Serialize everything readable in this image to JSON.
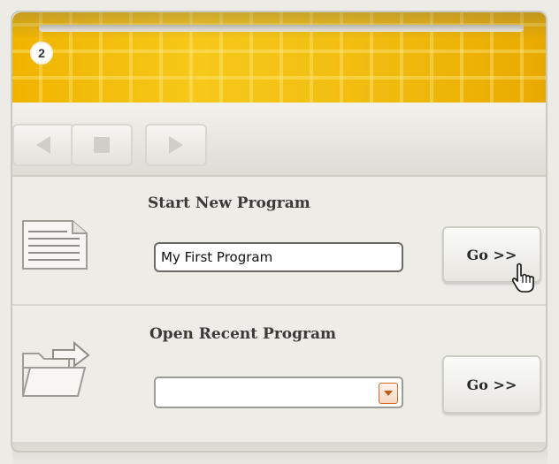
{
  "header": {
    "step_number": "2"
  },
  "toolbar": {
    "buttons": [
      {
        "name": "back",
        "icon": "triangle-left-icon"
      },
      {
        "name": "stop",
        "icon": "square-stop-icon"
      },
      {
        "name": "play",
        "icon": "triangle-right-icon"
      }
    ]
  },
  "start_new": {
    "title": "Start New Program",
    "input_value": "My First Program",
    "go_label": "Go >>",
    "icon": "document-icon"
  },
  "open_recent": {
    "title": "Open Recent Program",
    "select_value": "",
    "go_label": "Go >>",
    "icon": "open-folder-icon"
  },
  "colors": {
    "header_yellow": "#f1bd10",
    "select_arrow": "#c35a18"
  }
}
